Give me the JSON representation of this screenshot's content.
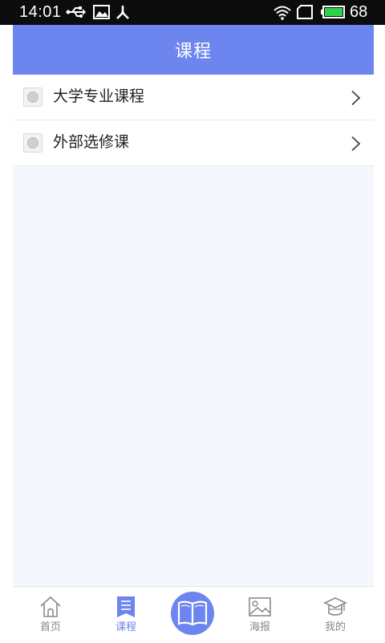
{
  "status_bar": {
    "time": "14:01",
    "battery_percent": "68",
    "icons": [
      "usb-icon",
      "image-icon",
      "debug-icon",
      "wifi-icon",
      "sim-icon",
      "battery-icon"
    ]
  },
  "header": {
    "title": "课程"
  },
  "course_list": [
    {
      "label": "大学专业课程",
      "icon": "course-thumbnail-icon"
    },
    {
      "label": "外部选修课",
      "icon": "course-thumbnail-icon"
    }
  ],
  "tab_bar": {
    "tabs": [
      {
        "label": "首页",
        "icon": "home-icon",
        "active": false
      },
      {
        "label": "课程",
        "icon": "course-list-icon",
        "active": true
      },
      {
        "label": "海报",
        "icon": "poster-image-icon",
        "active": false
      },
      {
        "label": "我的",
        "icon": "graduation-cap-icon",
        "active": false
      }
    ],
    "center_icon": "book-icon"
  },
  "colors": {
    "accent": "#6d86ef",
    "background": "#f4f7fd",
    "status_bar": "#0c0c0c",
    "text": "#222222",
    "inactive_tab": "#888888"
  }
}
